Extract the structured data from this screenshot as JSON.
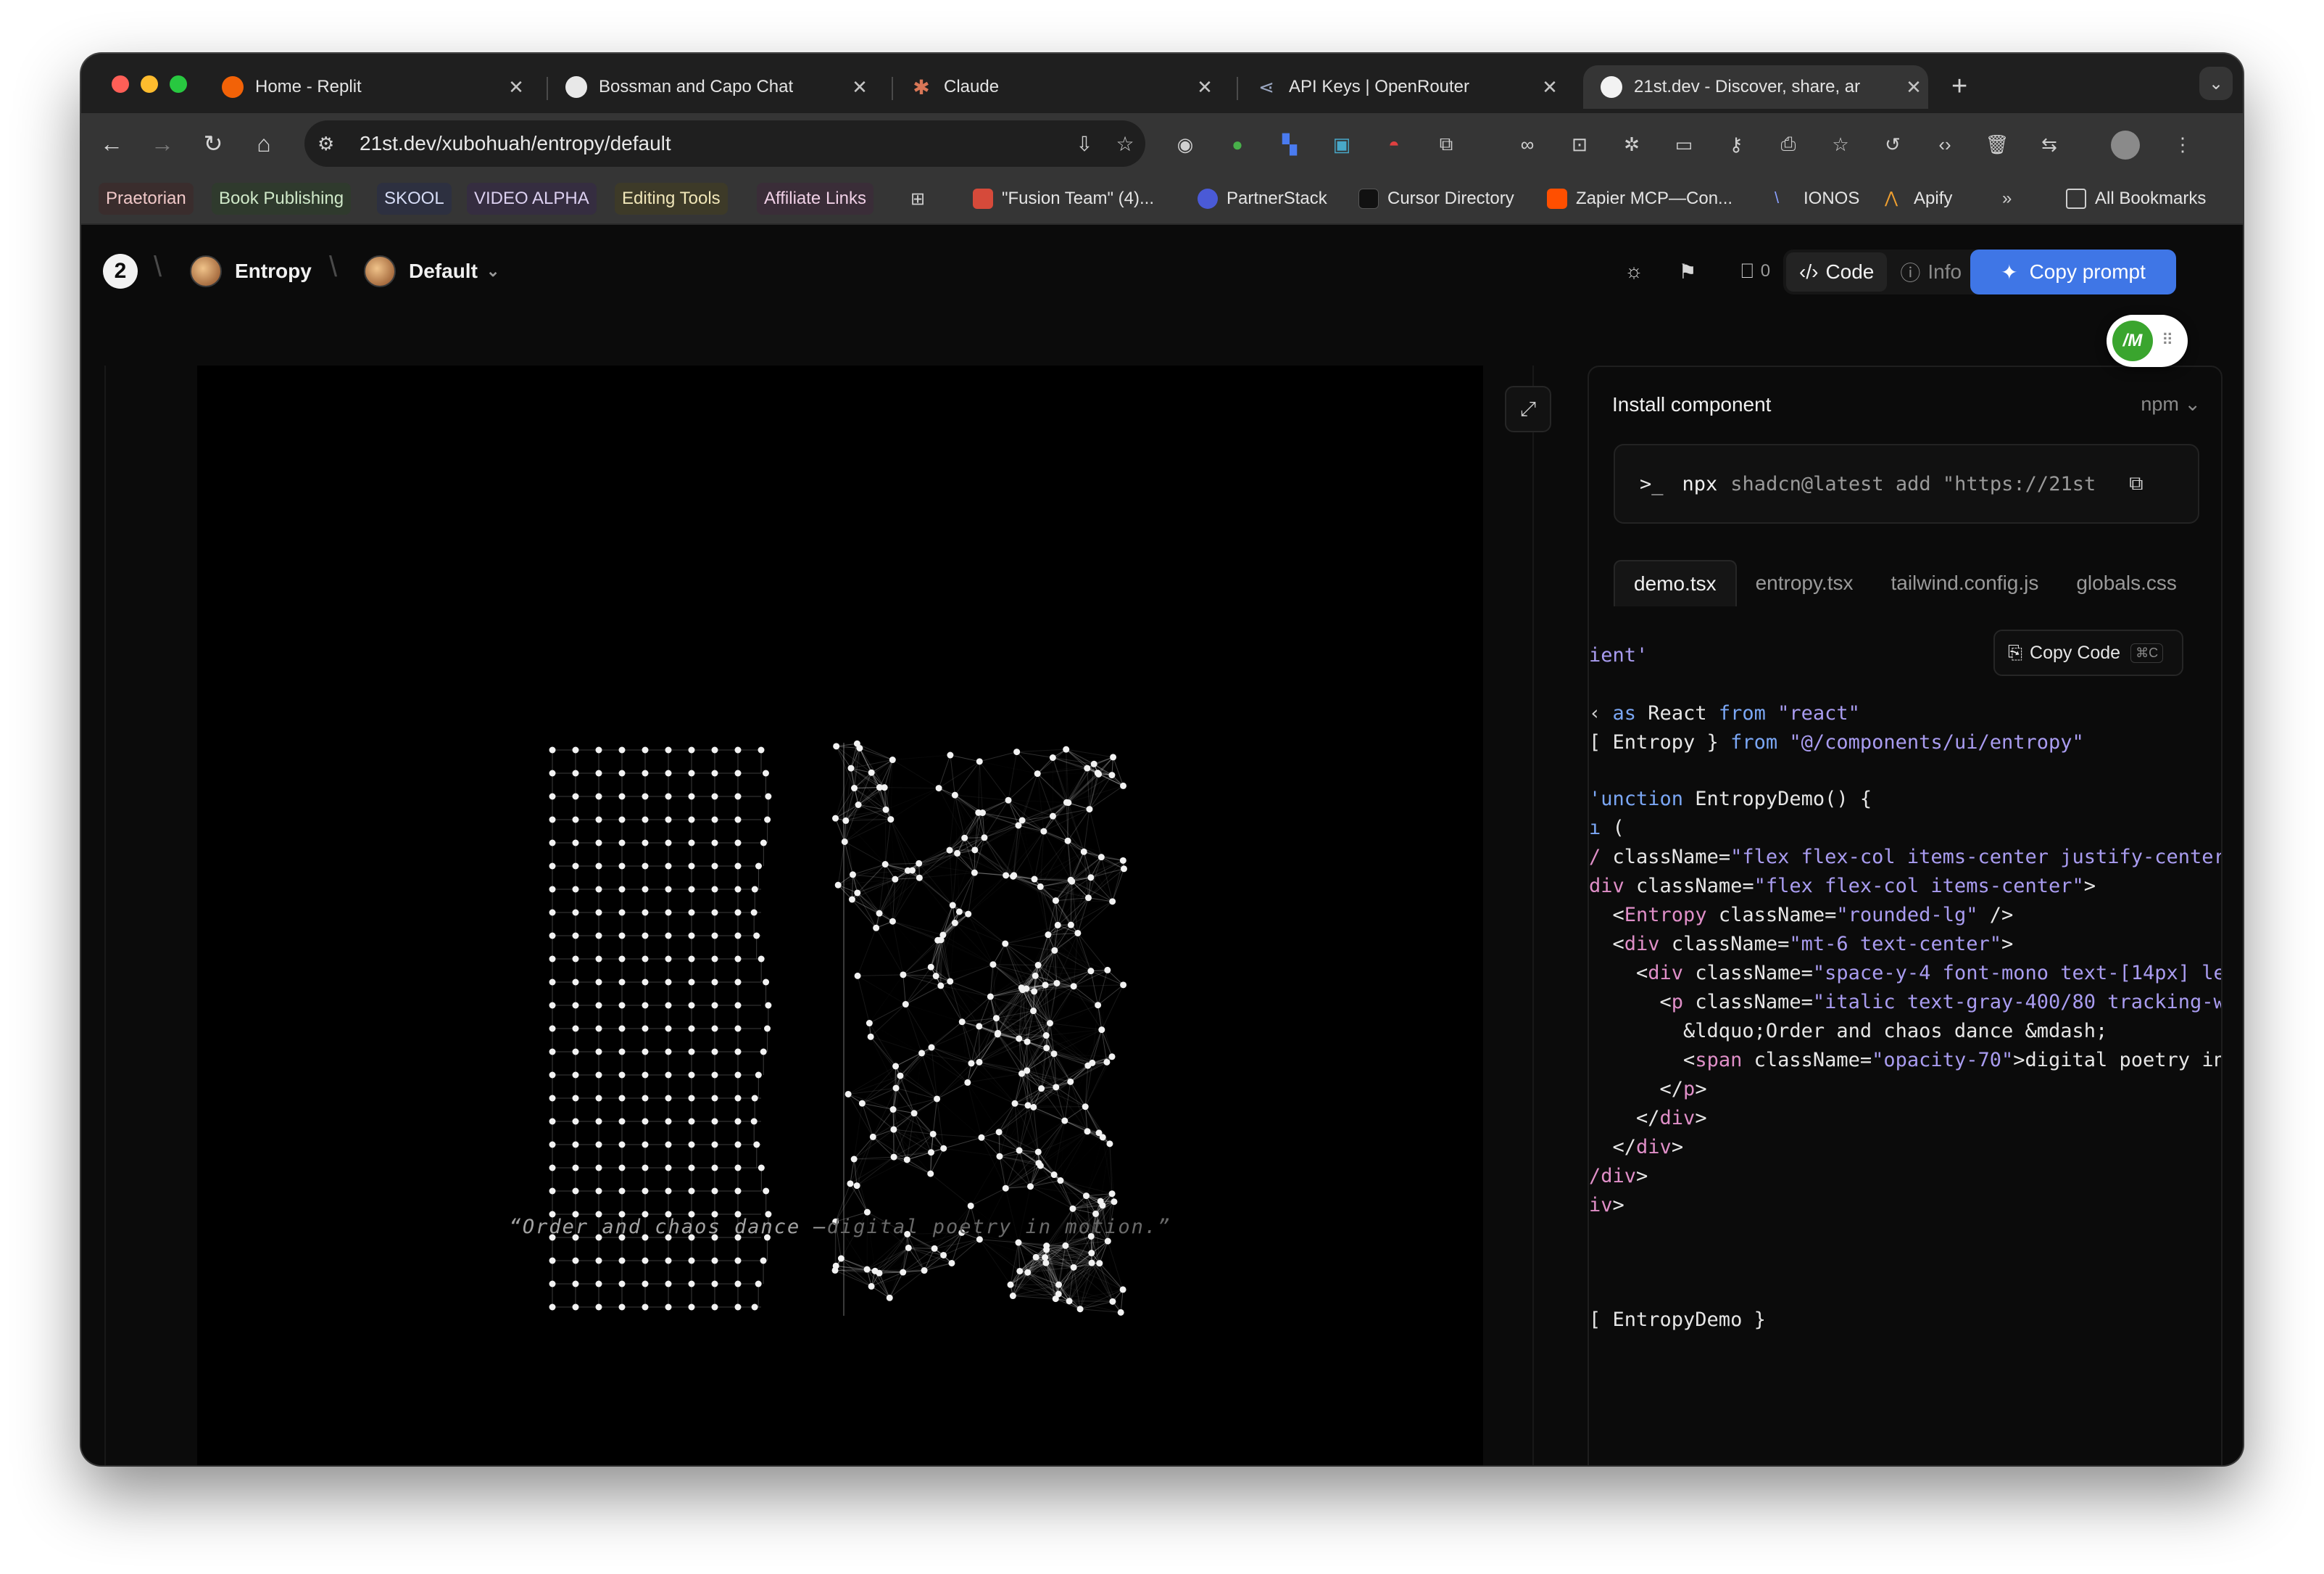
{
  "tabs": [
    {
      "title": "Home - Replit",
      "favicon": "replit-icon"
    },
    {
      "title": "Bossman and Capo Chat",
      "favicon": "openai-icon"
    },
    {
      "title": "Claude",
      "favicon": "claude-icon"
    },
    {
      "title": "API Keys | OpenRouter",
      "favicon": "openrouter-icon"
    },
    {
      "title": "21st.dev - Discover, share, ar",
      "favicon": "21st-icon"
    }
  ],
  "address": {
    "url": "21st.dev/xubohuah/entropy/default"
  },
  "bookmarks": [
    {
      "label": "Praetorian"
    },
    {
      "label": "Book Publishing"
    },
    {
      "label": "SKOOL"
    },
    {
      "label": "VIDEO ALPHA"
    },
    {
      "label": "Editing Tools"
    },
    {
      "label": "Affiliate Links"
    },
    {
      "label": "\"Fusion Team\" (4)..."
    },
    {
      "label": "PartnerStack"
    },
    {
      "label": "Cursor Directory"
    },
    {
      "label": "Zapier MCP—Con..."
    },
    {
      "label": "IONOS"
    },
    {
      "label": "Apify"
    },
    {
      "label": "»"
    },
    {
      "label": "All Bookmarks"
    }
  ],
  "header": {
    "component": "Entropy",
    "variant": "Default",
    "bookmark_count": "0",
    "code_label": "Code",
    "info_label": "Info",
    "copy_prompt": "Copy prompt"
  },
  "preview": {
    "quote_a": "“Order and chaos dance —",
    "quote_b": "digital poetry in motion.”"
  },
  "install": {
    "title": "Install component",
    "package_manager": "npm",
    "prompt": ">_",
    "command": "npx",
    "args": "shadcn@latest add \"https://21st"
  },
  "files": [
    "demo.tsx",
    "entropy.tsx",
    "tailwind.config.js",
    "globals.css"
  ],
  "copy_code": {
    "label": "Copy Code",
    "shortcut": "⌘C"
  },
  "badge": {
    "label": "/M"
  },
  "colors": {
    "accent": "#3f76e6",
    "bg": "#0b0b0b"
  }
}
